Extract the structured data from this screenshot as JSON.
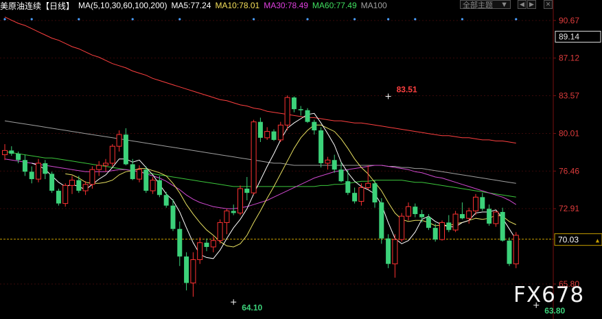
{
  "header": {
    "symbol": "美原油连续【日线】",
    "indicator": "MA(5,10,30,60,100,200)",
    "ma5": "MA5:77.24",
    "ma10": "MA10:78.01",
    "ma30": "MA30:78.49",
    "ma60": "MA60:77.49",
    "ma100": "MA100",
    "theme_select": "全部主题",
    "colors": {
      "symbol": "#ffffff",
      "indicator": "#ffffff",
      "ma5": "#ffffff",
      "ma10": "#f5e05a",
      "ma30": "#e040e0",
      "ma60": "#40e060",
      "ma100": "#a0a0a0"
    }
  },
  "watermark": "FX678",
  "chart_data": {
    "type": "candlestick",
    "price_axis_ticks": [
      "90.67",
      "87.12",
      "83.57",
      "80.01",
      "76.46",
      "72.91",
      "65.80"
    ],
    "current_price": "70.03",
    "boxed_price": "89.14",
    "ylim": [
      62.5,
      91.5
    ],
    "annotations": [
      {
        "text": "83.51",
        "price": 83.51,
        "bar": 57
      },
      {
        "text": "64.10",
        "price": 64.1,
        "bar": 34
      },
      {
        "text": "63.80",
        "price": 63.8,
        "bar": 79
      }
    ],
    "colors": {
      "up": "#ff3232",
      "down": "#3cd27a",
      "ma5": "#ffffff",
      "ma10": "#e8e060",
      "ma30": "#d24ad2",
      "ma60": "#3cc83c",
      "ma100": "#a0a0a0",
      "ma200": "#ff4040",
      "grid": "#3a0a0a",
      "current_line": "#c8a000"
    },
    "ohlc": [
      [
        78.0,
        79.0,
        77.5,
        78.4
      ],
      [
        78.4,
        78.8,
        77.9,
        78.1
      ],
      [
        78.1,
        78.3,
        77.2,
        77.5
      ],
      [
        77.5,
        78.0,
        76.0,
        76.4
      ],
      [
        76.4,
        76.9,
        75.3,
        75.7
      ],
      [
        75.7,
        77.6,
        75.4,
        77.2
      ],
      [
        77.2,
        77.5,
        75.7,
        76.2
      ],
      [
        76.2,
        76.4,
        74.4,
        74.6
      ],
      [
        74.6,
        74.8,
        73.2,
        73.4
      ],
      [
        73.4,
        75.3,
        73.1,
        75.1
      ],
      [
        75.1,
        76.0,
        74.3,
        75.6
      ],
      [
        75.6,
        76.0,
        74.4,
        74.6
      ],
      [
        74.6,
        75.5,
        74.2,
        75.2
      ],
      [
        75.2,
        76.9,
        74.8,
        76.6
      ],
      [
        76.6,
        77.4,
        76.0,
        77.0
      ],
      [
        77.0,
        77.6,
        76.4,
        77.2
      ],
      [
        77.2,
        79.0,
        76.9,
        78.8
      ],
      [
        78.8,
        80.3,
        78.3,
        79.9
      ],
      [
        79.9,
        80.5,
        77.0,
        77.1
      ],
      [
        77.1,
        77.6,
        75.6,
        75.7
      ],
      [
        75.7,
        77.0,
        75.4,
        76.6
      ],
      [
        76.6,
        76.9,
        74.4,
        74.6
      ],
      [
        74.6,
        75.9,
        74.3,
        75.6
      ],
      [
        75.6,
        76.0,
        74.0,
        74.2
      ],
      [
        74.2,
        74.5,
        73.0,
        73.2
      ],
      [
        73.2,
        73.8,
        70.8,
        71.0
      ],
      [
        71.0,
        71.7,
        67.5,
        68.4
      ],
      [
        68.4,
        68.8,
        65.2,
        65.9
      ],
      [
        65.9,
        68.8,
        64.6,
        68.1
      ],
      [
        68.1,
        70.2,
        67.7,
        69.7
      ],
      [
        69.7,
        70.1,
        68.9,
        69.3
      ],
      [
        69.3,
        70.3,
        68.8,
        69.9
      ],
      [
        69.9,
        71.9,
        69.6,
        71.6
      ],
      [
        71.6,
        72.9,
        70.5,
        72.7
      ],
      [
        72.7,
        73.3,
        72.3,
        72.5
      ],
      [
        72.5,
        75.1,
        72.3,
        74.8
      ],
      [
        74.8,
        75.9,
        73.7,
        74.4
      ],
      [
        74.4,
        81.3,
        74.2,
        81.1
      ],
      [
        81.1,
        81.5,
        79.2,
        79.6
      ],
      [
        79.6,
        80.6,
        79.4,
        80.2
      ],
      [
        80.2,
        80.4,
        79.3,
        79.4
      ],
      [
        79.4,
        81.1,
        79.2,
        80.8
      ],
      [
        80.8,
        83.6,
        80.3,
        83.4
      ],
      [
        83.4,
        83.5,
        82.0,
        82.3
      ],
      [
        82.3,
        82.6,
        81.7,
        82.2
      ],
      [
        82.2,
        82.4,
        81.0,
        81.1
      ],
      [
        81.1,
        81.3,
        79.9,
        80.3
      ],
      [
        80.3,
        80.6,
        76.8,
        77.2
      ],
      [
        77.2,
        77.8,
        76.6,
        77.5
      ],
      [
        77.5,
        78.0,
        76.3,
        76.6
      ],
      [
        76.6,
        77.3,
        75.4,
        75.5
      ],
      [
        75.5,
        76.6,
        74.2,
        74.4
      ],
      [
        74.4,
        74.9,
        73.4,
        73.6
      ],
      [
        73.6,
        75.3,
        73.2,
        74.9
      ],
      [
        74.9,
        77.0,
        74.7,
        75.3
      ],
      [
        75.3,
        75.6,
        73.0,
        73.5
      ],
      [
        73.5,
        73.9,
        69.6,
        70.1
      ],
      [
        70.1,
        70.5,
        67.3,
        67.7
      ],
      [
        67.7,
        70.5,
        66.4,
        70.0
      ],
      [
        70.0,
        72.5,
        69.8,
        72.2
      ],
      [
        72.2,
        73.5,
        71.8,
        73.1
      ],
      [
        73.1,
        73.4,
        72.1,
        72.4
      ],
      [
        72.4,
        72.8,
        71.6,
        72.1
      ],
      [
        72.1,
        72.4,
        70.9,
        71.1
      ],
      [
        71.1,
        71.5,
        69.8,
        70.0
      ],
      [
        70.0,
        71.8,
        69.9,
        71.6
      ],
      [
        71.6,
        72.3,
        70.7,
        70.9
      ],
      [
        70.9,
        72.7,
        70.7,
        72.4
      ],
      [
        72.4,
        73.5,
        71.9,
        72.0
      ],
      [
        72.0,
        73.0,
        71.5,
        72.7
      ],
      [
        72.7,
        74.3,
        72.3,
        74.0
      ],
      [
        74.0,
        74.4,
        72.7,
        72.9
      ],
      [
        72.9,
        73.3,
        71.3,
        71.5
      ],
      [
        71.5,
        72.7,
        71.2,
        72.6
      ],
      [
        72.6,
        73.0,
        69.8,
        69.9
      ],
      [
        69.9,
        70.2,
        67.5,
        67.7
      ],
      [
        67.7,
        70.7,
        67.3,
        70.4
      ]
    ],
    "ma5": [
      null,
      null,
      null,
      null,
      77.2,
      77.0,
      76.6,
      76.0,
      75.4,
      75.0,
      75.2,
      75.0,
      74.7,
      75.2,
      75.7,
      76.1,
      76.8,
      77.6,
      77.6,
      77.3,
      77.5,
      76.8,
      76.1,
      75.2,
      74.3,
      73.7,
      72.6,
      71.1,
      69.7,
      68.6,
      68.3,
      68.2,
      69.0,
      70.1,
      71.1,
      71.9,
      72.9,
      74.3,
      75.6,
      76.9,
      78.1,
      79.4,
      80.5,
      81.0,
      81.4,
      81.8,
      81.9,
      81.0,
      80.0,
      78.9,
      77.3,
      76.3,
      75.5,
      75.0,
      74.7,
      74.3,
      73.3,
      71.6,
      70.1,
      69.6,
      69.9,
      70.7,
      71.9,
      72.2,
      71.7,
      71.4,
      71.2,
      71.2,
      71.6,
      71.8,
      72.5,
      72.6,
      72.6,
      72.8,
      72.0,
      71.0,
      70.0
    ],
    "ma10": [
      null,
      null,
      null,
      null,
      null,
      null,
      null,
      null,
      null,
      76.2,
      76.1,
      75.8,
      75.4,
      75.3,
      75.3,
      75.4,
      75.6,
      76.1,
      76.4,
      76.5,
      76.7,
      76.7,
      76.5,
      76.3,
      76.0,
      75.3,
      74.4,
      73.3,
      72.4,
      71.6,
      70.9,
      70.4,
      69.8,
      69.4,
      69.3,
      69.6,
      70.4,
      71.6,
      72.7,
      73.9,
      75.0,
      76.2,
      77.4,
      78.6,
      79.6,
      80.3,
      80.8,
      80.8,
      80.5,
      80.2,
      79.5,
      78.6,
      77.6,
      76.8,
      76.2,
      75.4,
      74.6,
      73.5,
      72.5,
      71.9,
      71.7,
      71.8,
      71.8,
      71.6,
      71.3,
      71.4,
      71.3,
      71.5,
      71.6,
      71.8,
      72.0,
      71.9,
      72.0,
      72.3,
      72.2,
      71.7,
      71.4
    ],
    "ma30": [
      77.6,
      77.5,
      77.4,
      77.3,
      77.2,
      77.1,
      77.0,
      76.9,
      76.8,
      76.7,
      76.6,
      76.5,
      76.4,
      76.4,
      76.4,
      76.4,
      76.5,
      76.6,
      76.6,
      76.5,
      76.4,
      76.2,
      76.0,
      75.8,
      75.5,
      75.1,
      74.7,
      74.2,
      73.8,
      73.5,
      73.3,
      73.1,
      73.0,
      72.9,
      72.9,
      73.0,
      73.1,
      73.3,
      73.5,
      73.7,
      74.0,
      74.3,
      74.6,
      74.9,
      75.2,
      75.5,
      75.8,
      76.0,
      76.2,
      76.4,
      76.5,
      76.6,
      76.7,
      76.8,
      76.9,
      77.0,
      77.0,
      76.9,
      76.8,
      76.7,
      76.6,
      76.4,
      76.3,
      76.1,
      75.9,
      75.8,
      75.6,
      75.4,
      75.2,
      75.0,
      74.8,
      74.6,
      74.4,
      74.2,
      74.0,
      73.7,
      73.3
    ],
    "ma60": [
      78.3,
      78.2,
      78.1,
      78.0,
      77.9,
      77.8,
      77.7,
      77.7,
      77.6,
      77.5,
      77.4,
      77.3,
      77.2,
      77.1,
      77.0,
      76.9,
      76.8,
      76.7,
      76.6,
      76.5,
      76.4,
      76.3,
      76.2,
      76.1,
      76.0,
      75.9,
      75.8,
      75.7,
      75.6,
      75.5,
      75.4,
      75.3,
      75.2,
      75.1,
      75.0,
      75.0,
      75.0,
      75.0,
      75.0,
      75.0,
      75.0,
      75.0,
      75.0,
      75.0,
      75.0,
      75.0,
      75.0,
      75.1,
      75.1,
      75.2,
      75.2,
      75.3,
      75.4,
      75.5,
      75.5,
      75.6,
      75.6,
      75.6,
      75.6,
      75.6,
      75.5,
      75.4,
      75.4,
      75.3,
      75.2,
      75.1,
      75.0,
      74.9,
      74.8,
      74.7,
      74.6,
      74.5,
      74.4,
      74.3,
      74.2,
      74.1,
      74.0
    ],
    "ma100": [
      81.2,
      81.1,
      81.0,
      80.9,
      80.8,
      80.7,
      80.6,
      80.5,
      80.4,
      80.3,
      80.2,
      80.1,
      80.0,
      79.9,
      79.8,
      79.7,
      79.6,
      79.5,
      79.4,
      79.3,
      79.2,
      79.1,
      79.0,
      78.9,
      78.8,
      78.7,
      78.6,
      78.5,
      78.4,
      78.3,
      78.2,
      78.1,
      78.0,
      77.9,
      77.8,
      77.7,
      77.6,
      77.5,
      77.4,
      77.3,
      77.2,
      77.2,
      77.1,
      77.0,
      77.0,
      77.0,
      77.0,
      77.0,
      77.0,
      77.0,
      77.0,
      77.0,
      77.0,
      77.0,
      77.0,
      77.0,
      77.0,
      76.9,
      76.9,
      76.8,
      76.8,
      76.7,
      76.7,
      76.6,
      76.5,
      76.4,
      76.3,
      76.2,
      76.1,
      76.0,
      75.9,
      75.8,
      75.7,
      75.6,
      75.5,
      75.4,
      75.3
    ],
    "ma200": [
      91.0,
      90.7,
      90.4,
      90.2,
      89.9,
      89.6,
      89.3,
      89.0,
      88.8,
      88.5,
      88.2,
      88.0,
      87.7,
      87.4,
      87.2,
      86.9,
      86.6,
      86.4,
      86.2,
      85.9,
      85.7,
      85.5,
      85.2,
      85.0,
      84.8,
      84.6,
      84.4,
      84.2,
      84.0,
      83.8,
      83.6,
      83.4,
      83.2,
      83.1,
      82.9,
      82.7,
      82.6,
      82.4,
      82.3,
      82.1,
      82.0,
      81.9,
      81.8,
      81.7,
      81.6,
      81.5,
      81.5,
      81.4,
      81.3,
      81.2,
      81.2,
      81.1,
      81.0,
      81.0,
      80.9,
      80.8,
      80.7,
      80.6,
      80.5,
      80.4,
      80.3,
      80.2,
      80.1,
      80.0,
      79.9,
      79.8,
      79.8,
      79.7,
      79.6,
      79.6,
      79.5,
      79.4,
      79.4,
      79.3,
      79.3,
      79.2,
      79.1
    ]
  }
}
